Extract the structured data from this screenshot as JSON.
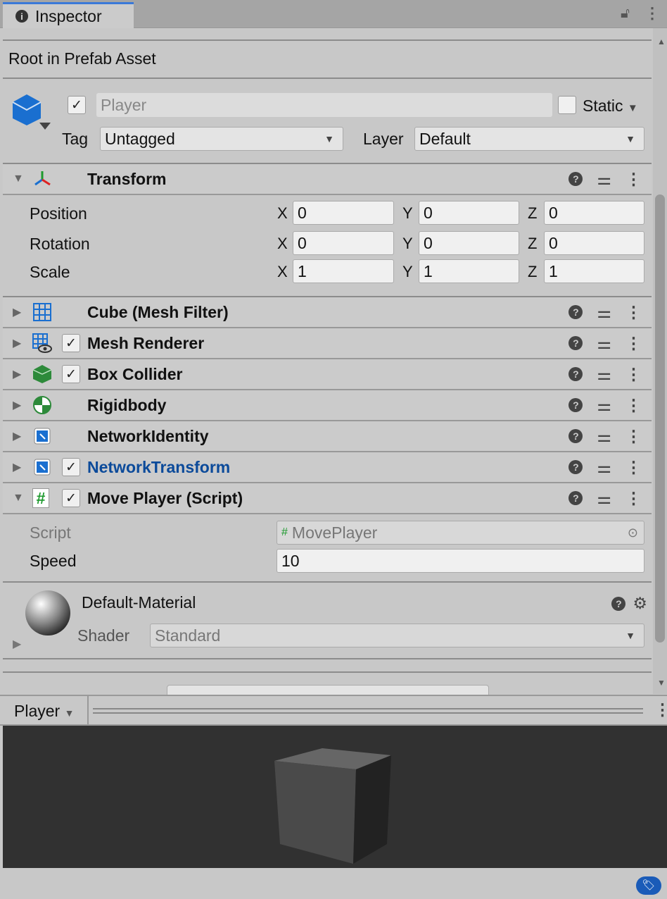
{
  "tab": {
    "title": "Inspector"
  },
  "prefab_header": "Root in Prefab Asset",
  "gameobject": {
    "name": "Player",
    "active": true,
    "static_label": "Static",
    "static": false,
    "tag_label": "Tag",
    "tag": "Untagged",
    "layer_label": "Layer",
    "layer": "Default"
  },
  "transform": {
    "title": "Transform",
    "rows": [
      {
        "label": "Position",
        "x": "0",
        "y": "0",
        "z": "0"
      },
      {
        "label": "Rotation",
        "x": "0",
        "y": "0",
        "z": "0"
      },
      {
        "label": "Scale",
        "x": "1",
        "y": "1",
        "z": "1"
      }
    ],
    "axes": {
      "x": "X",
      "y": "Y",
      "z": "Z"
    }
  },
  "components": [
    {
      "title": "Cube (Mesh Filter)",
      "icon": "mesh-filter-icon",
      "checkbox": false
    },
    {
      "title": "Mesh Renderer",
      "icon": "mesh-renderer-icon",
      "checkbox": true
    },
    {
      "title": "Box Collider",
      "icon": "box-collider-icon",
      "checkbox": true
    },
    {
      "title": "Rigidbody",
      "icon": "rigidbody-icon",
      "checkbox": false
    },
    {
      "title": "NetworkIdentity",
      "icon": "network-icon",
      "checkbox": false
    },
    {
      "title": "NetworkTransform",
      "icon": "network-icon",
      "checkbox": true,
      "color": "#0b4a9a"
    }
  ],
  "script_comp": {
    "title": "Move Player (Script)",
    "script_label": "Script",
    "script_value": "MovePlayer",
    "speed_label": "Speed",
    "speed_value": "10"
  },
  "material": {
    "name": "Default-Material",
    "shader_label": "Shader",
    "shader": "Standard"
  },
  "preview": {
    "title": "Player"
  }
}
